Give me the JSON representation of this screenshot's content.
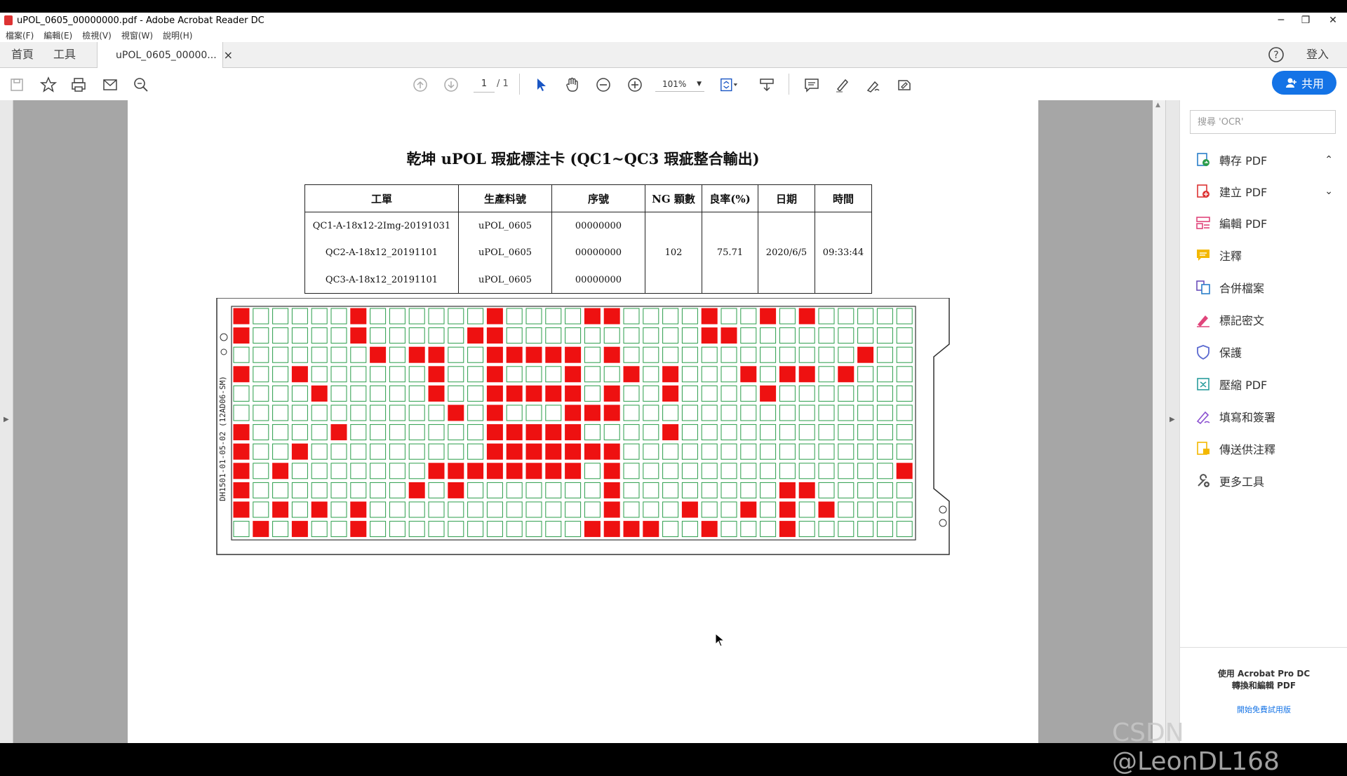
{
  "window": {
    "title": "uPOL_0605_00000000.pdf - Adobe Acrobat Reader DC"
  },
  "menu": [
    "檔案(F)",
    "編輯(E)",
    "檢視(V)",
    "視窗(W)",
    "說明(H)"
  ],
  "tabs": {
    "home": "首頁",
    "tools": "工具",
    "document": "uPOL_0605_00000...",
    "close": "×",
    "sign_in": "登入"
  },
  "toolbar": {
    "page_current": "1",
    "page_total": "/ 1",
    "zoom": "101%",
    "share": "共用"
  },
  "document": {
    "title": "乾坤 uPOL 瑕疵標注卡 (QC1~QC3 瑕疵整合輸出)",
    "headers": [
      "工單",
      "生產料號",
      "序號",
      "NG 顆數",
      "良率(%)",
      "日期",
      "時間"
    ],
    "rows": [
      {
        "work_order": "QC1-A-18x12-2Img-20191031",
        "part_no": "uPOL_0605",
        "serial": "00000000"
      },
      {
        "work_order": "QC2-A-18x12_20191101",
        "part_no": "uPOL_0605",
        "serial": "00000000"
      },
      {
        "work_order": "QC3-A-18x12_20191101",
        "part_no": "uPOL_0605",
        "serial": "00000000"
      }
    ],
    "ng_count": "102",
    "yield": "75.71",
    "date": "2020/6/5",
    "time": "09:33:44",
    "board_label": "DH1501-01-05-02 (12AD06-SM)",
    "grid": {
      "cols": 35,
      "rows": 12,
      "defects": [
        [
          0,
          6,
          13,
          18,
          19,
          24,
          27,
          29
        ],
        [
          0,
          6,
          12,
          13,
          24,
          25
        ],
        [
          7,
          9,
          10,
          13,
          14,
          15,
          16,
          17,
          19,
          32
        ],
        [
          0,
          3,
          10,
          13,
          17,
          20,
          22,
          26,
          28,
          29,
          31
        ],
        [
          4,
          10,
          13,
          14,
          15,
          16,
          17,
          19,
          22,
          27
        ],
        [
          11,
          13,
          17,
          18,
          19
        ],
        [
          0,
          5,
          13,
          14,
          15,
          16,
          17,
          22
        ],
        [
          0,
          3,
          13,
          14,
          15,
          16,
          17,
          18,
          19
        ],
        [
          0,
          2,
          10,
          11,
          12,
          13,
          14,
          15,
          16,
          17,
          19,
          34
        ],
        [
          0,
          9,
          11,
          19,
          28,
          29
        ],
        [
          0,
          2,
          4,
          6,
          19,
          23,
          26,
          28,
          30
        ],
        [
          1,
          3,
          6,
          18,
          19,
          20,
          21,
          24,
          28
        ]
      ]
    }
  },
  "right_panel": {
    "search_placeholder": "搜尋 'OCR'",
    "items": [
      "轉存 PDF",
      "建立 PDF",
      "編輯 PDF",
      "注釋",
      "合併檔案",
      "標記密文",
      "保護",
      "壓縮 PDF",
      "填寫和簽署",
      "傳送供注釋",
      "更多工具"
    ],
    "footer_line1": "使用 Acrobat Pro DC",
    "footer_line2": "轉換和編輯 PDF",
    "footer_link": "開始免費試用版"
  },
  "watermark": "CSDN @LeonDL168",
  "colors": {
    "accent": "#1473e6",
    "defect": "#ee1111",
    "cell_border": "#2a9d4a"
  }
}
